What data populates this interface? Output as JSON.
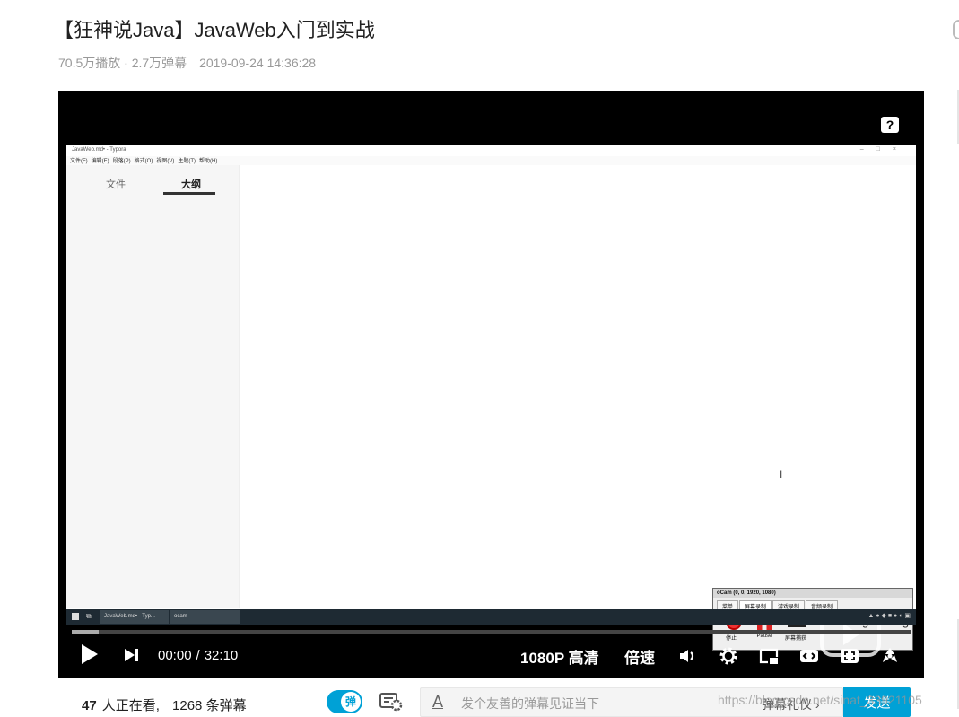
{
  "video": {
    "title": "【狂神说Java】JavaWeb入门到实战",
    "plays": "70.5万播放",
    "danmaku_count_short": "2.7万弹幕",
    "date": "2019-09-24 14:36:28"
  },
  "screen": {
    "window_title": "JavaWeb.md• - Typora",
    "menu": [
      "文件(F)",
      "编辑(E)",
      "段落(P)",
      "格式(O)",
      "视图(V)",
      "主题(T)",
      "帮助(H)"
    ],
    "sidebar_tabs": [
      "文件",
      "大纲"
    ],
    "sidebar_footer": "<  </>",
    "taskbar_items": [
      "JavaWeb.md• - Typ...",
      "ocam"
    ],
    "ocam": {
      "title": "oCam (0, 0, 1920, 1080)",
      "tabs": [
        "菜单",
        "屏幕录制",
        "游戏录制",
        "音频录制"
      ],
      "buttons": [
        "停止",
        "Pause",
        "屏幕捕获"
      ],
      "status": "RecordingStarting"
    }
  },
  "player": {
    "help_label": "?",
    "current_time": "00:00",
    "separator": "/",
    "duration": "32:10",
    "quality_label": "1080P 高清",
    "speed_label": "倍速",
    "progress_fraction": 0.0
  },
  "bottom": {
    "viewers_count": "47",
    "viewers_label": "人正在看,",
    "danmaku_total": "1268",
    "danmaku_label": "条弹幕",
    "toggle_label": "弹",
    "input_placeholder": "发个友善的弹幕见证当下",
    "gift_label": "弹幕礼仪 ›",
    "send_label": "发送",
    "text_style_icon": "A"
  },
  "watermark": "https://blog.csdn.net/sinat_33921105",
  "colors": {
    "accent": "#00a1d6",
    "player_bg": "#000000"
  }
}
